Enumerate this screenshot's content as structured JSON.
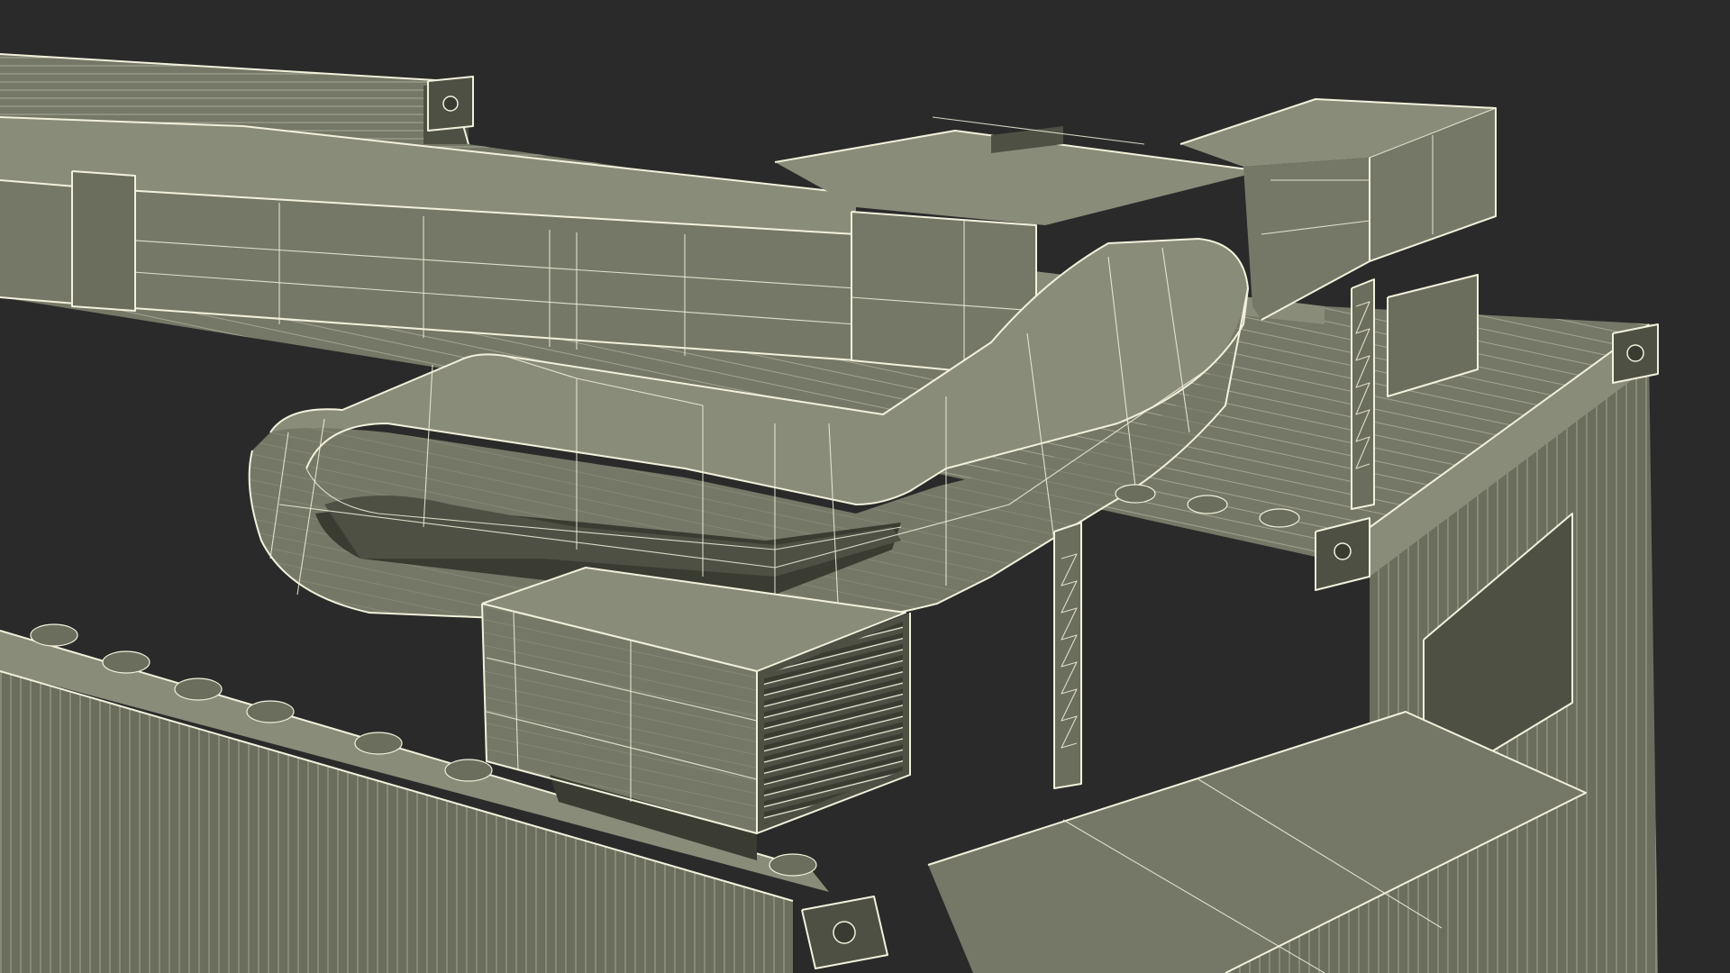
{
  "scene": {
    "subject": "wireframe-render",
    "colors": {
      "background": "#2a2a2a",
      "surface": "#767867",
      "surface_light": "#8a8c7a",
      "surface_mid": "#6b6d5d",
      "surface_dark": "#4e5044",
      "shadow": "#3a3c32",
      "wire": "#f2f1dc"
    }
  }
}
